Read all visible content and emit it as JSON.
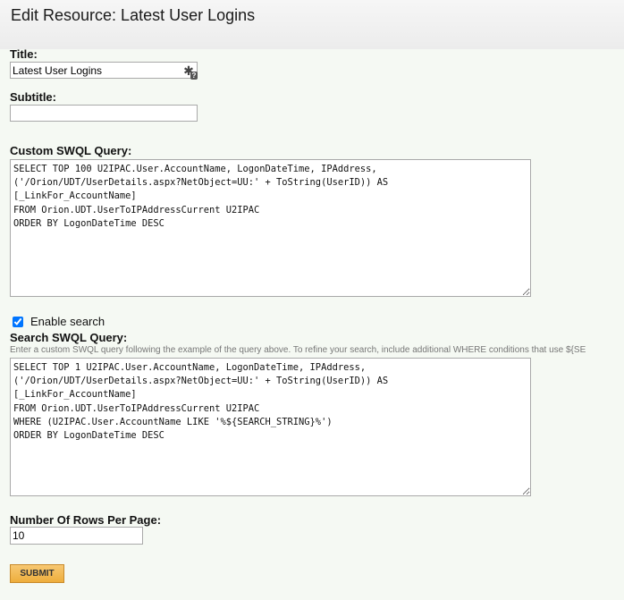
{
  "page": {
    "title": "Edit Resource: Latest User Logins"
  },
  "form": {
    "title_label": "Title:",
    "title_value": "Latest User Logins",
    "subtitle_label": "Subtitle:",
    "subtitle_value": "",
    "custom_query_label": "Custom SWQL Query:",
    "custom_query_value": "SELECT TOP 100 U2IPAC.User.AccountName, LogonDateTime, IPAddress,\n('/Orion/UDT/UserDetails.aspx?NetObject=UU:' + ToString(UserID)) AS\n[_LinkFor_AccountName]\nFROM Orion.UDT.UserToIPAddressCurrent U2IPAC\nORDER BY LogonDateTime DESC",
    "enable_search_label": "Enable search",
    "enable_search_checked": true,
    "search_query_label": "Search SWQL Query:",
    "search_query_hint": "Enter a custom SWQL query following the example of the query above. To refine your search, include additional WHERE conditions that use ${SE",
    "search_query_value": "SELECT TOP 1 U2IPAC.User.AccountName, LogonDateTime, IPAddress,\n('/Orion/UDT/UserDetails.aspx?NetObject=UU:' + ToString(UserID)) AS\n[_LinkFor_AccountName]\nFROM Orion.UDT.UserToIPAddressCurrent U2IPAC\nWHERE (U2IPAC.User.AccountName LIKE '%${SEARCH_STRING}%')\nORDER BY LogonDateTime DESC",
    "rows_label": "Number Of Rows Per Page:",
    "rows_value": "10",
    "submit_label": "SUBMIT"
  },
  "icons": {
    "title_helper": "macro-wand-icon"
  }
}
